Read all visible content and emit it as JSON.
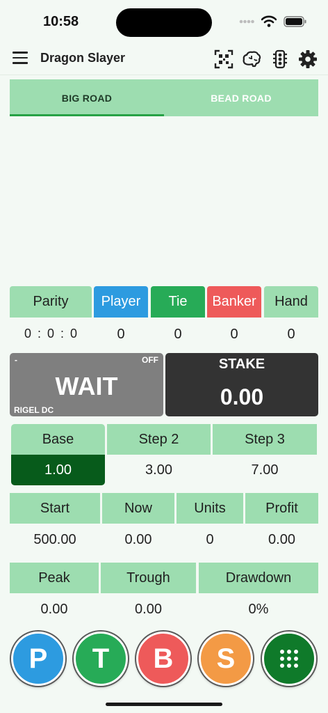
{
  "status_bar": {
    "time": "10:58"
  },
  "header": {
    "title": "Dragon Slayer"
  },
  "tabs": [
    {
      "label": "BIG ROAD",
      "active": true
    },
    {
      "label": "BEAD ROAD",
      "active": false
    }
  ],
  "outcomes": {
    "parity": {
      "label": "Parity",
      "value": "0 : 0 : 0"
    },
    "player": {
      "label": "Player",
      "value": "0",
      "color": "#2d9be0"
    },
    "tie": {
      "label": "Tie",
      "value": "0",
      "color": "#27ab57"
    },
    "banker": {
      "label": "Banker",
      "value": "0",
      "color": "#ee5a5a"
    },
    "hand": {
      "label": "Hand",
      "value": "0"
    }
  },
  "signal": {
    "dash": "-",
    "toggle": "OFF",
    "status": "WAIT",
    "system": "RIGEL DC"
  },
  "stake": {
    "label": "STAKE",
    "value": "0.00"
  },
  "steps": {
    "base": {
      "label": "Base",
      "value": "1.00"
    },
    "step2": {
      "label": "Step 2",
      "value": "3.00"
    },
    "step3": {
      "label": "Step 3",
      "value": "7.00"
    }
  },
  "bankroll": {
    "start": {
      "label": "Start",
      "value": "500.00"
    },
    "now": {
      "label": "Now",
      "value": "0.00"
    },
    "units": {
      "label": "Units",
      "value": "0"
    },
    "profit": {
      "label": "Profit",
      "value": "0.00"
    }
  },
  "stats": {
    "peak": {
      "label": "Peak",
      "value": "0.00"
    },
    "trough": {
      "label": "Trough",
      "value": "0.00"
    },
    "drawdown": {
      "label": "Drawdown",
      "value": "0%"
    }
  },
  "actions": {
    "player": {
      "label": "P",
      "color": "#2d9be0"
    },
    "tie": {
      "label": "T",
      "color": "#27ab57"
    },
    "banker": {
      "label": "B",
      "color": "#ee5a5a"
    },
    "skip": {
      "label": "S",
      "color": "#f39a45"
    },
    "keypad": {
      "icon": "keypad-icon",
      "color": "#0f7a2a"
    }
  },
  "icons": [
    "menu-icon",
    "qr-scan-icon",
    "brain-icon",
    "traffic-light-icon",
    "gear-icon",
    "wifi-icon",
    "battery-icon"
  ]
}
